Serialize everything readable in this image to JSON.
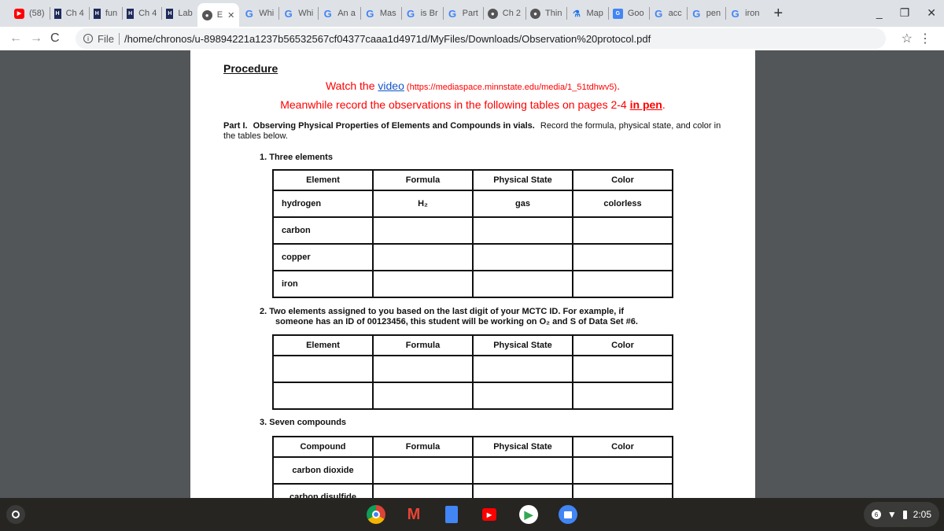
{
  "tabs": [
    {
      "icon": "youtube-icon",
      "label": "(58)"
    },
    {
      "icon": "bookmark-icon",
      "label": "Ch 4"
    },
    {
      "icon": "bookmark-icon",
      "label": "fun"
    },
    {
      "icon": "bookmark-icon",
      "label": "Ch 4"
    },
    {
      "icon": "bookmark-icon",
      "label": "Lab"
    },
    {
      "icon": "globe-icon",
      "label": "E",
      "active": true
    },
    {
      "icon": "google-icon",
      "label": "Whi"
    },
    {
      "icon": "google-icon",
      "label": "Whi"
    },
    {
      "icon": "google-icon",
      "label": "An a"
    },
    {
      "icon": "google-icon",
      "label": "Mas"
    },
    {
      "icon": "google-icon",
      "label": "is Br"
    },
    {
      "icon": "google-icon",
      "label": "Part"
    },
    {
      "icon": "globe-icon",
      "label": "Ch 2"
    },
    {
      "icon": "globe-icon",
      "label": "Thin"
    },
    {
      "icon": "flask-icon",
      "label": "Map"
    },
    {
      "icon": "translate-icon",
      "label": "Goo"
    },
    {
      "icon": "google-icon",
      "label": "acc"
    },
    {
      "icon": "google-icon",
      "label": "pen"
    },
    {
      "icon": "google-icon",
      "label": "iron"
    }
  ],
  "address": {
    "scheme_label": "File",
    "url": "/home/chronos/u-89894221a1237b56532567cf04377caaa1d4971d/MyFiles/Downloads/Observation%20protocol.pdf"
  },
  "doc": {
    "heading": "Procedure",
    "watch_prefix": "Watch the ",
    "watch_link": "video",
    "watch_url": " (https://mediaspace.minnstate.edu/media/1_51tdhwv5)",
    "watch_suffix": ".",
    "meanwhile": "Meanwhile record the observations in the following tables on pages 2-4 ",
    "meanwhile_emph": "in pen",
    "meanwhile_suffix": ".",
    "part_label": "Part I.",
    "part_title": "Observing Physical Properties of Elements and Compounds in vials.",
    "part_text": "Record the formula, physical state, and color in the tables below.",
    "sec1": "1.   Three elements",
    "sec2_line1": "2.  Two elements assigned to you based on the last digit of your MCTC ID. For example, if",
    "sec2_line2": "someone has an ID of 00123456, this student will be working on O₂ and S of Data Set #6.",
    "sec3": "3.  Seven compounds",
    "table1": {
      "headers": [
        "Element",
        "Formula",
        "Physical State",
        "Color"
      ],
      "rows": [
        [
          "hydrogen",
          "H₂",
          "gas",
          "colorless"
        ],
        [
          "carbon",
          "",
          "",
          ""
        ],
        [
          "copper",
          "",
          "",
          ""
        ],
        [
          "iron",
          "",
          "",
          ""
        ]
      ]
    },
    "table2": {
      "headers": [
        "Element",
        "Formula",
        "Physical State",
        "Color"
      ],
      "rows": [
        [
          "",
          "",
          "",
          ""
        ],
        [
          "",
          "",
          "",
          ""
        ]
      ]
    },
    "table3": {
      "headers": [
        "Compound",
        "Formula",
        "Physical State",
        "Color"
      ],
      "rows": [
        [
          "carbon dioxide",
          "",
          "",
          ""
        ],
        [
          "carbon disulfide",
          "",
          "",
          ""
        ]
      ]
    }
  },
  "shelf": {
    "apps": [
      "chrome-icon",
      "gmail-icon",
      "docs-icon",
      "youtube-icon",
      "play-store-icon",
      "files-icon"
    ],
    "notification_count": "6",
    "time": "2:05"
  }
}
